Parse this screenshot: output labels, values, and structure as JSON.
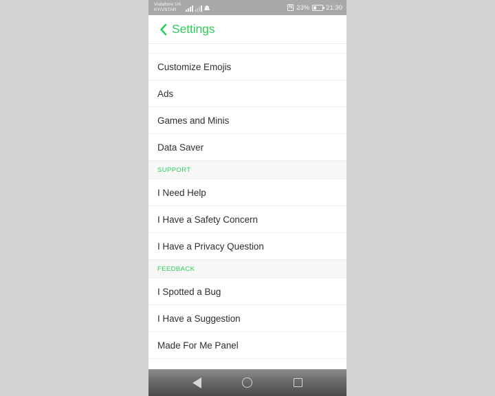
{
  "status_bar": {
    "carrier_line1": "Vodafone UA",
    "carrier_line2": "KYIVSTAR",
    "signal_icon_1": "signal-bars-icon",
    "signal_icon_2": "signal-bars-icon",
    "notification_icon": "bell-icon",
    "nfc_icon": "nfc-icon",
    "nfc_glyph": "N",
    "battery_percent": "23%",
    "battery_icon": "battery-icon",
    "time": "21:30",
    "background_color": "#a9a9a9"
  },
  "header": {
    "back_icon": "chevron-left-icon",
    "title": "Settings",
    "accent_color": "#2ecc58"
  },
  "list": {
    "sections": [
      {
        "header": null,
        "items": [
          {
            "label": "Customize Emojis"
          },
          {
            "label": "Ads"
          },
          {
            "label": "Games and Minis"
          },
          {
            "label": "Data Saver"
          }
        ]
      },
      {
        "header": "SUPPORT",
        "items": [
          {
            "label": "I Need Help"
          },
          {
            "label": "I Have a Safety Concern"
          },
          {
            "label": "I Have a Privacy Question"
          }
        ]
      },
      {
        "header": "FEEDBACK",
        "items": [
          {
            "label": "I Spotted a Bug"
          },
          {
            "label": "I Have a Suggestion"
          },
          {
            "label": "Made For Me Panel"
          }
        ]
      }
    ]
  },
  "nav_bar": {
    "back_icon": "triangle-back-icon",
    "home_icon": "circle-home-icon",
    "recents_icon": "square-recents-icon"
  },
  "colors": {
    "page_background": "#d4d4d4",
    "screen_background": "#ffffff",
    "accent_green": "#2ecc58",
    "row_text": "#2f2f35",
    "section_background": "#f7f7f8",
    "divider": "#eeeeee"
  }
}
